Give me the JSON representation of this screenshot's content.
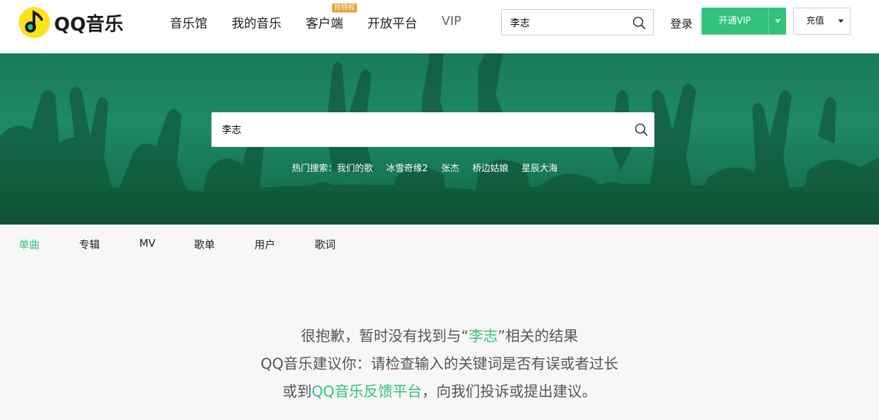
{
  "header": {
    "logo_text": "QQ音乐",
    "nav": [
      {
        "label": "音乐馆"
      },
      {
        "label": "我的音乐"
      },
      {
        "label": "客户端"
      },
      {
        "label": "开放平台"
      },
      {
        "label": "VIP"
      }
    ],
    "promo_badge": "抢特权",
    "search_value": "李志",
    "login": "登录",
    "vip_button": "开通VIP",
    "recharge_button": "充值"
  },
  "banner": {
    "search_value": "李志",
    "hot_label": "热门搜索：",
    "hot_items": [
      "我们的歌",
      "冰雪奇缘2",
      "张杰",
      "桥边姑娘",
      "星辰大海"
    ]
  },
  "tabs": [
    {
      "label": "单曲",
      "active": true
    },
    {
      "label": "专辑"
    },
    {
      "label": "MV"
    },
    {
      "label": "歌单"
    },
    {
      "label": "用户"
    },
    {
      "label": "歌词"
    }
  ],
  "empty": {
    "l1_a": "很抱歉，暂时没有找到与",
    "l1_q1": "“",
    "l1_kw": "李志",
    "l1_q2": "”",
    "l1_b": "相关的结果",
    "l2": "QQ音乐建议你：请检查输入的关键词是否有误或者过长",
    "l3_a": "或到",
    "l3_link": "QQ音乐反馈平台",
    "l3_b": "，向我们投诉或提出建议。"
  },
  "colors": {
    "accent": "#31c27c",
    "logo": "#ffe21e",
    "badge": "#e8a03d"
  },
  "icons": [
    "qq-music-logo-icon",
    "search-icon",
    "dropdown-caret-icon"
  ]
}
